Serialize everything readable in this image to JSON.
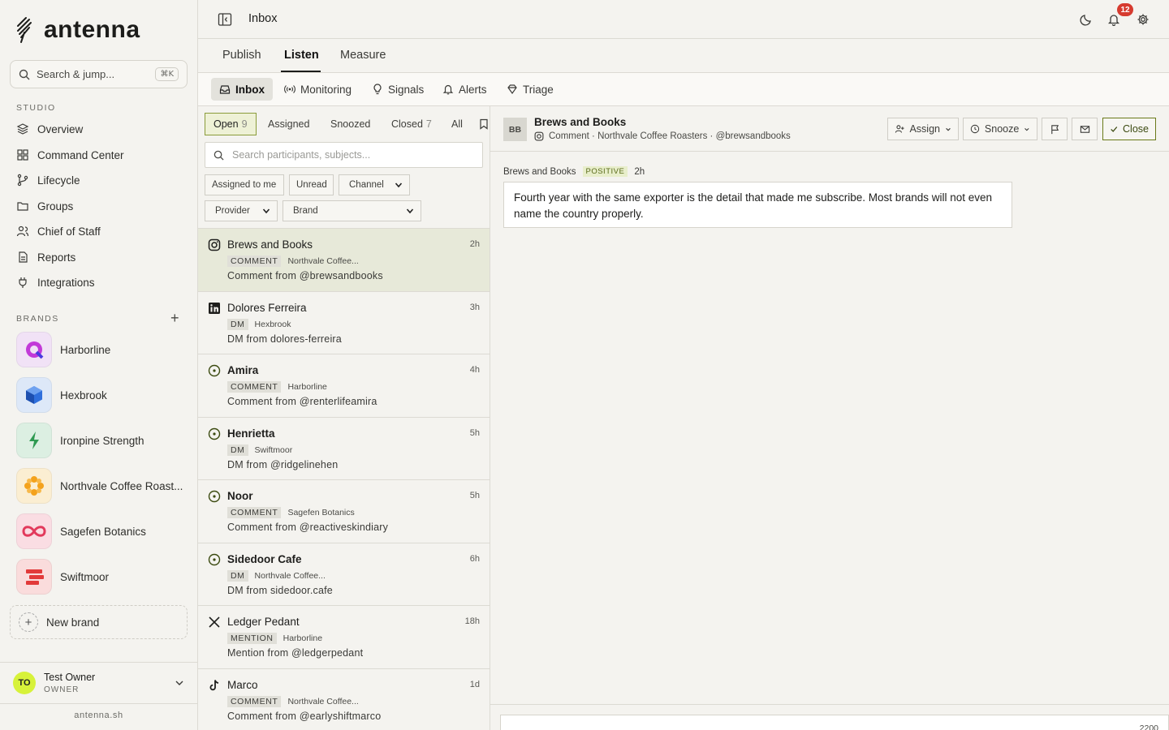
{
  "app": {
    "logo_text": "antenna",
    "search_placeholder": "Search & jump...",
    "search_kbd": "⌘K",
    "footer_site": "antenna.sh"
  },
  "sidebar": {
    "studio_label": "STUDIO",
    "studio_items": [
      {
        "label": "Overview",
        "icon": "layers-icon"
      },
      {
        "label": "Command Center",
        "icon": "grid-icon"
      },
      {
        "label": "Lifecycle",
        "icon": "branch-icon"
      },
      {
        "label": "Groups",
        "icon": "folder-icon"
      },
      {
        "label": "Chief of Staff",
        "icon": "users-icon"
      },
      {
        "label": "Reports",
        "icon": "document-icon"
      },
      {
        "label": "Integrations",
        "icon": "plug-icon"
      }
    ],
    "brands_label": "BRANDS",
    "brands": [
      {
        "label": "Harborline",
        "color": "#b64bdc"
      },
      {
        "label": "Hexbrook",
        "color": "#2f6fdc"
      },
      {
        "label": "Ironpine Strength",
        "color": "#2f9a52"
      },
      {
        "label": "Northvale Coffee Roast...",
        "color": "#f4a21c"
      },
      {
        "label": "Sagefen Botanics",
        "color": "#e23a5c"
      },
      {
        "label": "Swiftmoor",
        "color": "#e23a3a"
      }
    ],
    "new_brand_label": "New brand",
    "user": {
      "initials": "TO",
      "name": "Test Owner",
      "role": "OWNER"
    }
  },
  "header": {
    "title": "Inbox",
    "notification_count": "12",
    "tabs": [
      "Publish",
      "Listen",
      "Measure"
    ],
    "active_tab": "Listen",
    "subtabs": [
      "Inbox",
      "Monitoring",
      "Signals",
      "Alerts",
      "Triage"
    ],
    "active_subtab": "Inbox"
  },
  "list": {
    "filter_tabs": [
      {
        "label": "Open",
        "count": "9"
      },
      {
        "label": "Assigned",
        "count": ""
      },
      {
        "label": "Snoozed",
        "count": ""
      },
      {
        "label": "Closed",
        "count": "7"
      },
      {
        "label": "All",
        "count": ""
      }
    ],
    "search_placeholder": "Search participants, subjects...",
    "filters": {
      "assigned_to_me": "Assigned to me",
      "unread": "Unread",
      "channel": "Channel",
      "provider": "Provider",
      "brand": "Brand"
    },
    "conversations": [
      {
        "name": "Brews and Books",
        "time": "2h",
        "tag": "COMMENT",
        "brand": "Northvale Coffee...",
        "subtitle": "Comment from @brewsandbooks",
        "network": "instagram-icon",
        "bold": false
      },
      {
        "name": "Dolores Ferreira",
        "time": "3h",
        "tag": "DM",
        "brand": "Hexbrook",
        "subtitle": "DM from dolores-ferreira",
        "network": "linkedin-icon",
        "bold": false
      },
      {
        "name": "Amira",
        "time": "4h",
        "tag": "COMMENT",
        "brand": "Harborline",
        "subtitle": "Comment from @renterlifeamira",
        "network": "threads-icon",
        "bold": true
      },
      {
        "name": "Henrietta",
        "time": "5h",
        "tag": "DM",
        "brand": "Swiftmoor",
        "subtitle": "DM from @ridgelinehen",
        "network": "threads-icon",
        "bold": true
      },
      {
        "name": "Noor",
        "time": "5h",
        "tag": "COMMENT",
        "brand": "Sagefen Botanics",
        "subtitle": "Comment from @reactiveskindiary",
        "network": "threads-icon",
        "bold": true
      },
      {
        "name": "Sidedoor Cafe",
        "time": "6h",
        "tag": "DM",
        "brand": "Northvale Coffee...",
        "subtitle": "DM from sidedoor.cafe",
        "network": "threads-icon",
        "bold": true
      },
      {
        "name": "Ledger Pedant",
        "time": "18h",
        "tag": "MENTION",
        "brand": "Harborline",
        "subtitle": "Mention from @ledgerpedant",
        "network": "x-icon",
        "bold": false
      },
      {
        "name": "Marco",
        "time": "1d",
        "tag": "COMMENT",
        "brand": "Northvale Coffee...",
        "subtitle": "Comment from @earlyshiftmarco",
        "network": "tiktok-icon",
        "bold": false
      }
    ]
  },
  "detail": {
    "avatar": "BB",
    "title": "Brews and Books",
    "meta": "Comment · Northvale Coffee Roasters · @brewsandbooks",
    "buttons": {
      "assign": "Assign",
      "snooze": "Snooze",
      "close": "Close"
    },
    "message": {
      "author": "Brews and Books",
      "sentiment": "POSITIVE",
      "time": "2h",
      "text": "Fourth year with the same exporter is the detail that made me subscribe. Most brands will not even name the country properly."
    },
    "char_limit": "2200"
  }
}
